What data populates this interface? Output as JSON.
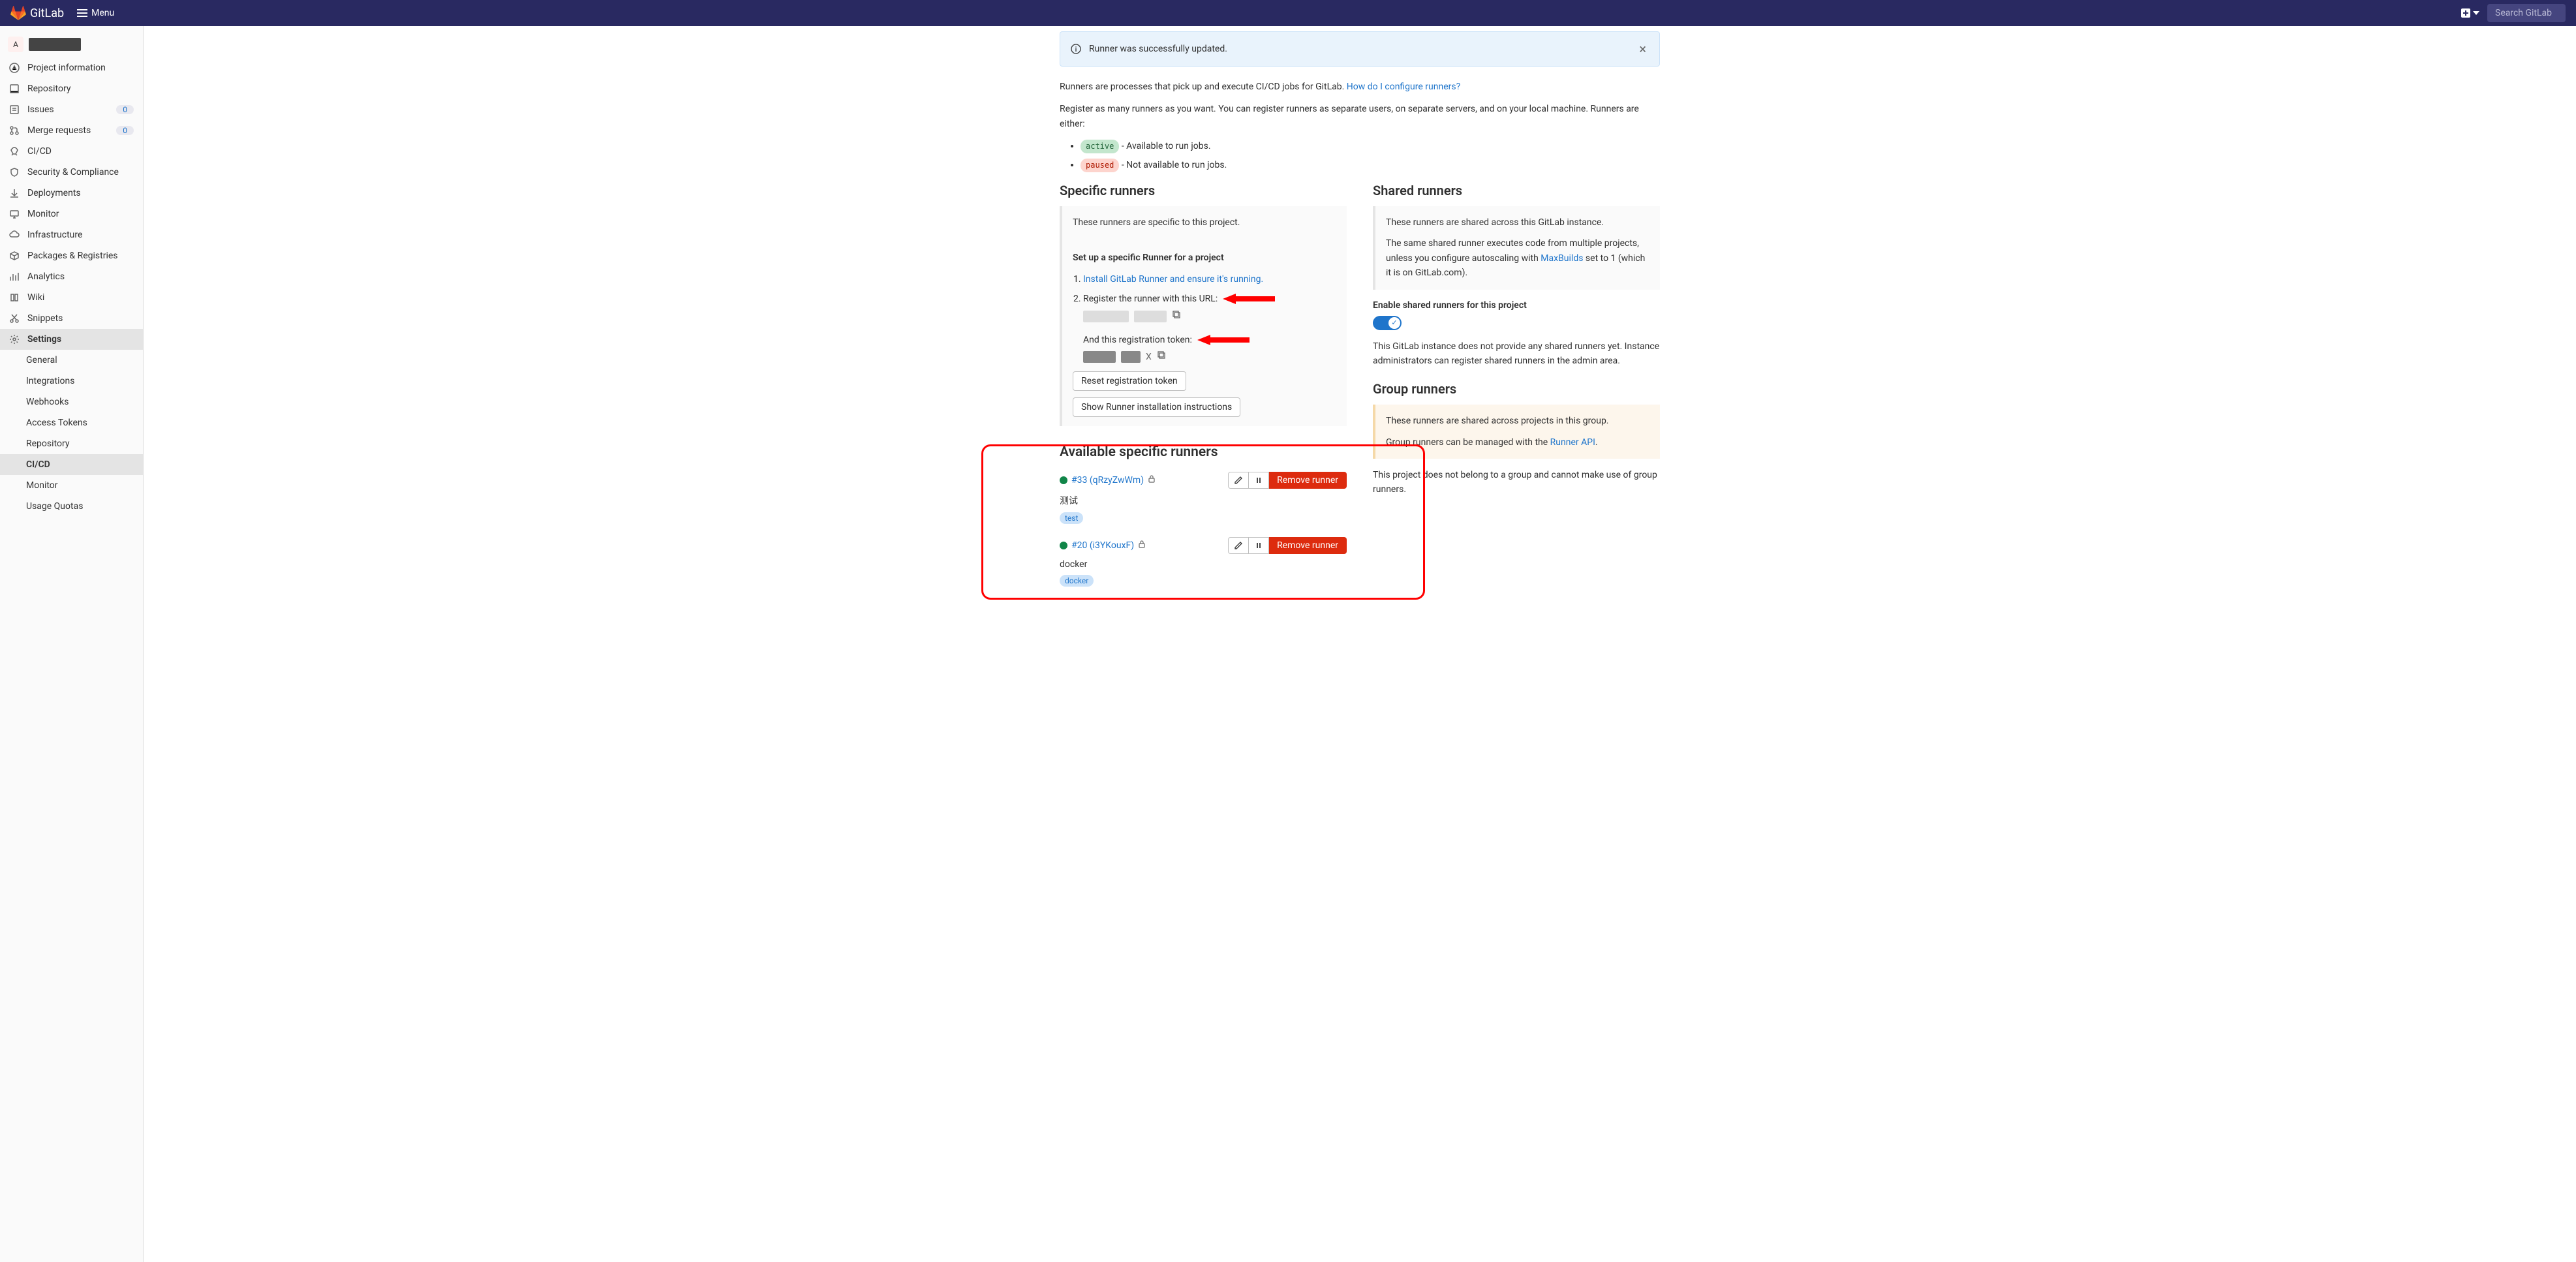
{
  "navbar": {
    "brand": "GitLab",
    "menu_label": "Menu",
    "search_placeholder": "Search GitLab"
  },
  "sidebar": {
    "project_avatar": "A",
    "items": [
      {
        "label": "Project information",
        "icon": "info"
      },
      {
        "label": "Repository",
        "icon": "repo"
      },
      {
        "label": "Issues",
        "icon": "issues",
        "badge": "0"
      },
      {
        "label": "Merge requests",
        "icon": "merge",
        "badge": "0"
      },
      {
        "label": "CI/CD",
        "icon": "rocket"
      },
      {
        "label": "Security & Compliance",
        "icon": "shield"
      },
      {
        "label": "Deployments",
        "icon": "deploy"
      },
      {
        "label": "Monitor",
        "icon": "monitor"
      },
      {
        "label": "Infrastructure",
        "icon": "cloud"
      },
      {
        "label": "Packages & Registries",
        "icon": "package"
      },
      {
        "label": "Analytics",
        "icon": "analytics"
      },
      {
        "label": "Wiki",
        "icon": "wiki"
      },
      {
        "label": "Snippets",
        "icon": "snippets"
      },
      {
        "label": "Settings",
        "icon": "gear",
        "active": true
      }
    ],
    "sub_items": [
      {
        "label": "General"
      },
      {
        "label": "Integrations"
      },
      {
        "label": "Webhooks"
      },
      {
        "label": "Access Tokens"
      },
      {
        "label": "Repository"
      },
      {
        "label": "CI/CD",
        "active": true
      },
      {
        "label": "Monitor"
      },
      {
        "label": "Usage Quotas"
      }
    ]
  },
  "alert": {
    "text": "Runner was successfully updated."
  },
  "intro": {
    "text1": "Runners are processes that pick up and execute CI/CD jobs for GitLab. ",
    "link1": "How do I configure runners?",
    "text2": "Register as many runners as you want. You can register runners as separate users, on separate servers, and on your local machine. Runners are either:",
    "active_badge": "active",
    "active_text": " - Available to run jobs.",
    "paused_badge": "paused",
    "paused_text": " - Not available to run jobs."
  },
  "specific": {
    "title": "Specific runners",
    "panel_intro": "These runners are specific to this project.",
    "setup_heading": "Set up a specific Runner for a project",
    "step1_link": "Install GitLab Runner and ensure it's running.",
    "step2_text": "Register the runner with this URL:",
    "token_text": "And this registration token:",
    "token_x": "X",
    "reset_btn": "Reset registration token",
    "show_btn": "Show Runner installation instructions"
  },
  "shared": {
    "title": "Shared runners",
    "panel_p1": "These runners are shared across this GitLab instance.",
    "panel_p2a": "The same shared runner executes code from multiple projects, unless you configure autoscaling with ",
    "panel_p2_link": "MaxBuilds",
    "panel_p2b": " set to 1 (which it is on GitLab.com).",
    "toggle_label": "Enable shared runners for this project",
    "no_shared_text": "This GitLab instance does not provide any shared runners yet. Instance administrators can register shared runners in the admin area."
  },
  "group": {
    "title": "Group runners",
    "panel_p1": "These runners are shared across projects in this group.",
    "panel_p2a": "Group runners can be managed with the ",
    "panel_p2_link": "Runner API",
    "panel_p2b": ".",
    "below_text": "This project does not belong to a group and cannot make use of group runners."
  },
  "available": {
    "title": "Available specific runners",
    "runners": [
      {
        "id": "#33 (qRzyZwWm)",
        "desc": "测试",
        "tag": "test",
        "remove": "Remove runner"
      },
      {
        "id": "#20 (i3YKouxF)",
        "desc": "docker",
        "tag": "docker",
        "remove": "Remove runner"
      }
    ]
  }
}
